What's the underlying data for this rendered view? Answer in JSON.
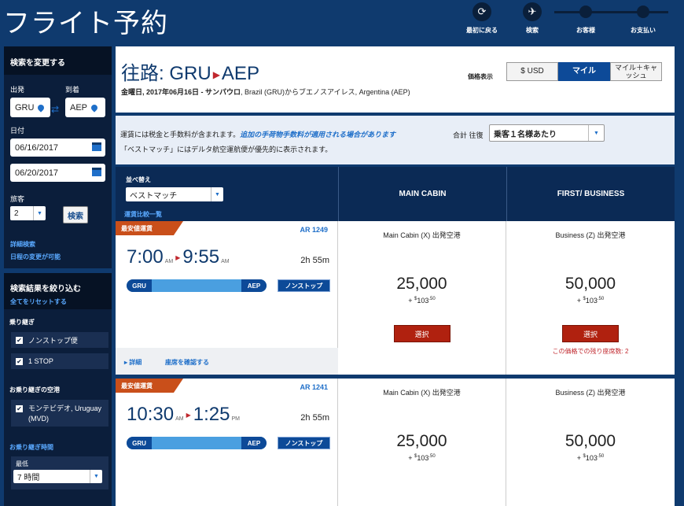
{
  "app_title": "フライト予約",
  "steps": [
    {
      "label": "最初に戻る",
      "icon": "refresh-icon"
    },
    {
      "label": "検索",
      "icon": "airplane-icon"
    },
    {
      "label": "お客様",
      "icon": "step-dot"
    },
    {
      "label": "お支払い",
      "icon": "step-dot"
    }
  ],
  "sidebar": {
    "header": "検索を変更する",
    "origin_label": "出発",
    "dest_label": "到着",
    "origin": "GRU",
    "dest": "AEP",
    "date_label": "日付",
    "depart_date": "06/16/2017",
    "return_date": "06/20/2017",
    "pax_label": "旅客",
    "pax": "2",
    "search_button": "検索",
    "advanced_search": "詳細検索",
    "flexible_dates": "日程の変更が可能"
  },
  "filters": {
    "header": "検索結果を絞り込む",
    "reset_all": "全てをリセットする",
    "connections_label": "乗り継ぎ",
    "nonstop": "ノンストップ便",
    "one_stop": "1 STOP",
    "connect_airport_label": "お乗り継ぎの空港",
    "connect_airport": "モンテビデオ, Uruguay (MVD)",
    "connect_time_label": "お乗り継ぎ時間",
    "min_label": "最低",
    "min_value": "7 時間"
  },
  "route": {
    "label": "往路:",
    "origin": "GRU",
    "dest": "AEP",
    "arrow": "▶",
    "subtitle_bold": "金曜日, 2017年06月16日 - サンパウロ",
    "subtitle_rest": ", Brazil (GRU)からブエノスアイレス, Argentina (AEP)"
  },
  "price_display": {
    "label": "価格表示",
    "options": [
      "$ USD",
      "マイル",
      "マイル＋キャッシュ"
    ],
    "selected": "マイル"
  },
  "info": {
    "line1_plain": "運賃には税金と手数料が含まれます。",
    "line1_link": "追加の手荷物手数料が適用される場合があります",
    "line2": "「ベストマッチ」にはデルタ航空運航便が優先的に表示されます。",
    "total_label": "合計 往復",
    "per_pax": "乗客１名様あたり"
  },
  "table_header": {
    "sort_label": "並べ替え",
    "sort_value": "ベストマッチ",
    "compare_link": "運賃比較一覧",
    "col_main": "MAIN CABIN",
    "col_first": "FIRST/ BUSINESS"
  },
  "flights": [
    {
      "badge": "最安値運賃",
      "flight_no": "AR 1249",
      "dep_time": "7:00",
      "dep_ampm": "AM",
      "arr_time": "9:55",
      "arr_ampm": "AM",
      "duration": "2h 55m",
      "from": "GRU",
      "to": "AEP",
      "stops": "ノンストップ",
      "details_link": "▸ 詳細",
      "seat_link": "座席を確認する",
      "main": {
        "cabin": "Main Cabin (X) 出発空港",
        "miles": "25,000",
        "tax_prefix": "+ ",
        "tax_sym": "$",
        "tax": "103",
        "tax_cents": ".50",
        "button": "選択"
      },
      "first": {
        "cabin": "Business (Z) 出発空港",
        "miles": "50,000",
        "tax_prefix": "+ ",
        "tax_sym": "$",
        "tax": "103",
        "tax_cents": ".50",
        "button": "選択",
        "seats_left": "この価格での残り座席数: 2"
      }
    },
    {
      "badge": "最安値運賃",
      "flight_no": "AR 1241",
      "dep_time": "10:30",
      "dep_ampm": "AM",
      "arr_time": "1:25",
      "arr_ampm": "PM",
      "duration": "2h 55m",
      "from": "GRU",
      "to": "AEP",
      "stops": "ノンストップ",
      "main": {
        "cabin": "Main Cabin (X) 出発空港",
        "miles": "25,000",
        "tax_prefix": "+ ",
        "tax_sym": "$",
        "tax": "103",
        "tax_cents": ".50"
      },
      "first": {
        "cabin": "Business (Z) 出発空港",
        "miles": "50,000",
        "tax_prefix": "+ ",
        "tax_sym": "$",
        "tax": "103",
        "tax_cents": ".50"
      }
    }
  ]
}
